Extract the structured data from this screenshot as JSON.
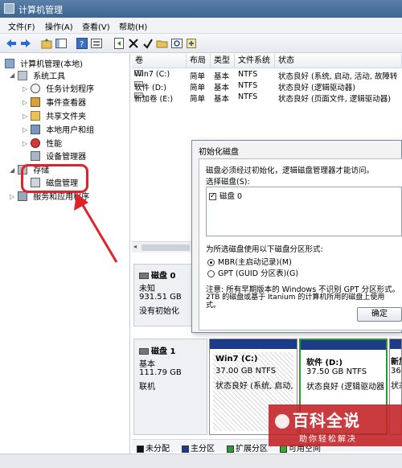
{
  "window": {
    "title": "计算机管理"
  },
  "menu": [
    {
      "label": "文件(F)"
    },
    {
      "label": "操作(A)"
    },
    {
      "label": "查看(V)"
    },
    {
      "label": "帮助(H)"
    }
  ],
  "tree": {
    "root": "计算机管理(本地)",
    "system_tools": "系统工具",
    "task_scheduler": "任务计划程序",
    "event_viewer": "事件查看器",
    "shared_folders": "共享文件夹",
    "local_users": "本地用户和组",
    "performance": "性能",
    "device_manager": "设备管理器",
    "storage": "存储",
    "disk_management": "磁盘管理",
    "services_apps": "服务和应用程序"
  },
  "table": {
    "columns": [
      "卷",
      "布局",
      "类型",
      "文件系统",
      "状态"
    ],
    "rows": [
      {
        "volume": "Win7 (C:)",
        "layout": "简单",
        "type": "基本",
        "fs": "NTFS",
        "status": "状态良好 (系统, 启动, 活动, 故障转"
      },
      {
        "volume": "软件 (D:)",
        "layout": "简单",
        "type": "基本",
        "fs": "NTFS",
        "status": "状态良好 (逻辑驱动器)"
      },
      {
        "volume": "新加卷 (E:)",
        "layout": "简单",
        "type": "基本",
        "fs": "NTFS",
        "status": "状态良好 (页面文件, 逻辑驱动器)"
      }
    ]
  },
  "disk0": {
    "name": "磁盘 0",
    "kind": "未知",
    "size": "931.51 GB",
    "state": "没有初始化"
  },
  "disk1": {
    "name": "磁盘 1",
    "kind": "基本",
    "size": "111.79 GB",
    "state": "联机"
  },
  "partitions": [
    {
      "name": "Win7 (C:)",
      "size": "37.00 GB NTFS",
      "status": "状态良好 (系统, 启动,"
    },
    {
      "name": "软件 (D:)",
      "size": "37.50 GB NTFS",
      "status": "状态良好 (逻辑驱动器"
    },
    {
      "name": "新加",
      "size": "36.",
      "status": "状态"
    }
  ],
  "legend": [
    {
      "label": "未分配",
      "color": "#111111"
    },
    {
      "label": "主分区",
      "color": "#1c3c8a"
    },
    {
      "label": "扩展分区",
      "color": "#2f9a2f"
    },
    {
      "label": "可用空间",
      "color": "#38a838"
    }
  ],
  "dialog": {
    "title": "初始化磁盘",
    "intro": "磁盘必须经过初始化，逻辑磁盘管理器才能访问。",
    "select_label": "选择磁盘(S):",
    "disk_item": "磁盘 0",
    "partition_style_label": "为所选磁盘使用以下磁盘分区形式:",
    "mbr": "MBR(主启动记录)(M)",
    "gpt": "GPT (GUID 分区表)(G)",
    "note_line1": "注意: 所有早期版本的 Windows 不识别 GPT 分区形式。",
    "note_line2": "2TB 的磁盘或基于 Itanium 的计算机所用的磁盘上使用",
    "note_line3": "式。",
    "ok_button": "确定"
  },
  "watermark": {
    "big": "百科全说",
    "small": "助你轻松解决"
  },
  "colors": {
    "highlight": "#e0232b",
    "primary_partition": "#1c3c8a"
  }
}
